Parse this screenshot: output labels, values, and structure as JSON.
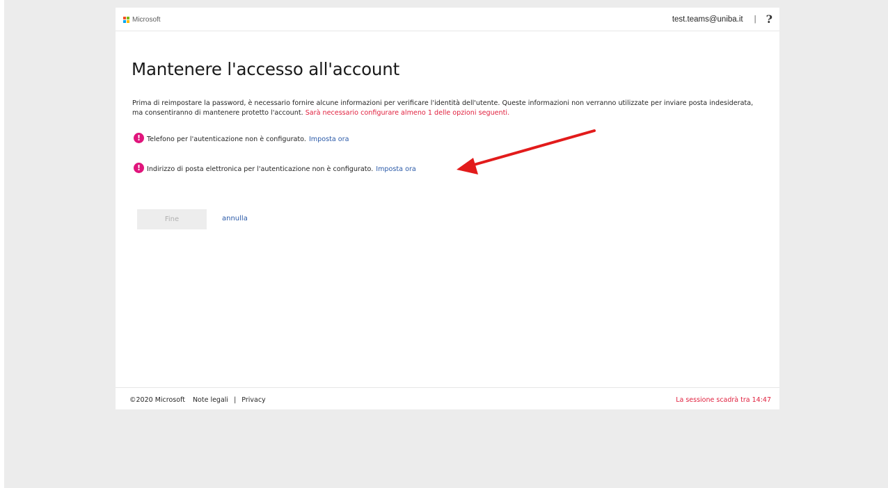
{
  "header": {
    "brand": "Microsoft",
    "brand_colors": [
      "#f25022",
      "#7fba00",
      "#00a4ef",
      "#ffb900"
    ],
    "user_email": "test.teams@uniba.it",
    "separator": "|",
    "help": "?"
  },
  "main": {
    "title": "Mantenere l'accesso all'account",
    "intro_text": "Prima di reimpostare la password, è necessario fornire alcune informazioni per verificare l'identità dell'utente. Queste informazioni non verranno utilizzate per inviare posta indesiderata, ma consentiranno di mantenere protetto l'account.",
    "intro_warning": "Sarà necessario configurare almeno 1 delle opzioni seguenti.",
    "requirements": [
      {
        "icon": "alert-icon",
        "text": "Telefono per l'autenticazione non è configurato.",
        "link": "Imposta ora"
      },
      {
        "icon": "alert-icon",
        "text": "Indirizzo di posta elettronica per l'autenticazione non è configurato.",
        "link": "Imposta ora"
      }
    ],
    "finish_button": "Fine",
    "cancel_link": "annulla"
  },
  "footer": {
    "copyright": "©2020 Microsoft",
    "legal": "Note legali",
    "separator": "|",
    "privacy": "Privacy",
    "session": "La sessione scadrà tra 14:47"
  },
  "colors": {
    "accent_link": "#2b5aa8",
    "warning_red": "#e01f3d",
    "alert_icon": "#e0157c",
    "annotation_arrow": "#e21b1b"
  }
}
